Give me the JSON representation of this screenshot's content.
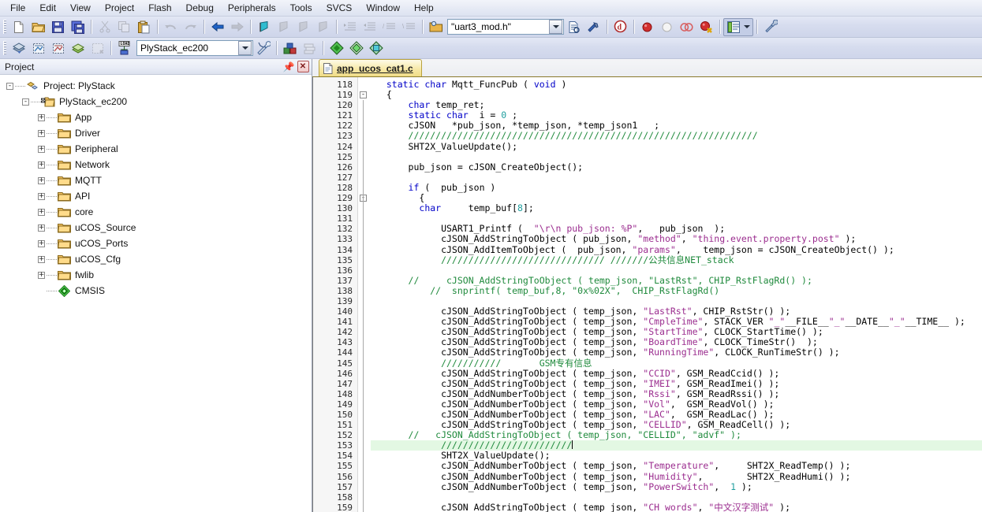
{
  "menubar": {
    "items": [
      {
        "label": "File"
      },
      {
        "label": "Edit"
      },
      {
        "label": "View"
      },
      {
        "label": "Project"
      },
      {
        "label": "Flash"
      },
      {
        "label": "Debug"
      },
      {
        "label": "Peripherals"
      },
      {
        "label": "Tools"
      },
      {
        "label": "SVCS"
      },
      {
        "label": "Window"
      },
      {
        "label": "Help"
      }
    ]
  },
  "toolbar1": {
    "file_combo_value": "\"uart3_mod.h\"",
    "icons": [
      "new-file-icon",
      "open-file-icon",
      "save-icon",
      "save-all-icon",
      "cut-icon",
      "copy-icon",
      "paste-icon",
      "undo-icon",
      "redo-icon",
      "navigate-back-icon",
      "navigate-forward-icon",
      "bookmark-toggle-icon",
      "bookmark-prev-icon",
      "bookmark-next-icon",
      "bookmark-clear-icon",
      "indent-icon",
      "outdent-icon",
      "comment-icon",
      "uncomment-icon",
      "browse-folder-icon",
      "find-in-files-icon",
      "goto-definition-icon",
      "find-icon",
      "insert-breakpoint-icon",
      "disable-breakpoint-icon",
      "disable-all-breakpoints-icon",
      "kill-all-breakpoints-icon",
      "window-layout-icon",
      "chevron-down-icon",
      "configure-icon"
    ]
  },
  "toolbar2": {
    "target_combo_value": "PlyStack_ec200",
    "icons": [
      "translate-icon",
      "build-icon",
      "rebuild-icon",
      "batch-build-icon",
      "stop-build-icon",
      "download-icon",
      "target-options-icon",
      "manage-project-items-icon",
      "components-icon",
      "pack-installer-icon",
      "manage-runtime-env-icon"
    ]
  },
  "project_pane": {
    "caption": "Project",
    "pin_icon": "pin-icon",
    "close_icon": "close-icon",
    "tree": [
      {
        "label": "Project: PlyStack",
        "depth": 0,
        "expander": "-",
        "icon": "project-icon"
      },
      {
        "label": "PlyStack_ec200",
        "depth": 1,
        "expander": "-",
        "icon": "target-folder-icon"
      },
      {
        "label": "App",
        "depth": 2,
        "expander": "+",
        "icon": "folder-icon"
      },
      {
        "label": "Driver",
        "depth": 2,
        "expander": "+",
        "icon": "folder-icon"
      },
      {
        "label": "Peripheral",
        "depth": 2,
        "expander": "+",
        "icon": "folder-icon"
      },
      {
        "label": "Network",
        "depth": 2,
        "expander": "+",
        "icon": "folder-icon"
      },
      {
        "label": "MQTT",
        "depth": 2,
        "expander": "+",
        "icon": "folder-icon"
      },
      {
        "label": "API",
        "depth": 2,
        "expander": "+",
        "icon": "folder-icon"
      },
      {
        "label": "core",
        "depth": 2,
        "expander": "+",
        "icon": "folder-icon"
      },
      {
        "label": "uCOS_Source",
        "depth": 2,
        "expander": "+",
        "icon": "folder-icon"
      },
      {
        "label": "uCOS_Ports",
        "depth": 2,
        "expander": "+",
        "icon": "folder-icon"
      },
      {
        "label": "uCOS_Cfg",
        "depth": 2,
        "expander": "+",
        "icon": "folder-icon"
      },
      {
        "label": "fwlib",
        "depth": 2,
        "expander": "+",
        "icon": "folder-icon"
      },
      {
        "label": "CMSIS",
        "depth": 2,
        "expander": "none",
        "icon": "cmsis-icon"
      }
    ]
  },
  "editor": {
    "tabs": [
      {
        "label": "app_ucos_cat1.c",
        "icon": "c-file-icon",
        "active": true
      }
    ],
    "first_line": 118,
    "current_line": 153,
    "lines": [
      {
        "n": 118,
        "fold": "",
        "bar": false,
        "tokens": [
          {
            "t": "  ",
            "c": "p"
          },
          {
            "t": "static",
            "c": "k"
          },
          {
            "t": " ",
            "c": "p"
          },
          {
            "t": "char",
            "c": "k"
          },
          {
            "t": " Mqtt_FuncPub ( ",
            "c": "p"
          },
          {
            "t": "void",
            "c": "k"
          },
          {
            "t": " )",
            "c": "p"
          }
        ]
      },
      {
        "n": 119,
        "fold": "-",
        "bar": false,
        "tokens": [
          {
            "t": "  {",
            "c": "p"
          }
        ]
      },
      {
        "n": 120,
        "fold": "",
        "bar": true,
        "tokens": [
          {
            "t": "      ",
            "c": "p"
          },
          {
            "t": "char",
            "c": "k"
          },
          {
            "t": " temp_ret;",
            "c": "p"
          }
        ]
      },
      {
        "n": 121,
        "fold": "",
        "bar": true,
        "tokens": [
          {
            "t": "      ",
            "c": "p"
          },
          {
            "t": "static",
            "c": "k"
          },
          {
            "t": " ",
            "c": "p"
          },
          {
            "t": "char",
            "c": "k"
          },
          {
            "t": "  i = ",
            "c": "p"
          },
          {
            "t": "0",
            "c": "n"
          },
          {
            "t": " ;",
            "c": "p"
          }
        ]
      },
      {
        "n": 122,
        "fold": "",
        "bar": true,
        "tokens": [
          {
            "t": "      cJSON   *pub_json, *temp_json, *temp_json1   ;",
            "c": "p"
          }
        ]
      },
      {
        "n": 123,
        "fold": "",
        "bar": true,
        "tokens": [
          {
            "t": "      ////////////////////////////////////////////////////////////////",
            "c": "c"
          }
        ]
      },
      {
        "n": 124,
        "fold": "",
        "bar": true,
        "tokens": [
          {
            "t": "      SHT2X_ValueUpdate();",
            "c": "p"
          }
        ]
      },
      {
        "n": 125,
        "fold": "",
        "bar": true,
        "tokens": [
          {
            "t": "",
            "c": "p"
          }
        ]
      },
      {
        "n": 126,
        "fold": "",
        "bar": true,
        "tokens": [
          {
            "t": "      pub_json = cJSON_CreateObject();",
            "c": "p"
          }
        ]
      },
      {
        "n": 127,
        "fold": "",
        "bar": true,
        "tokens": [
          {
            "t": "",
            "c": "p"
          }
        ]
      },
      {
        "n": 128,
        "fold": "",
        "bar": true,
        "tokens": [
          {
            "t": "      ",
            "c": "p"
          },
          {
            "t": "if",
            "c": "k"
          },
          {
            "t": " (  pub_json )",
            "c": "p"
          }
        ]
      },
      {
        "n": 129,
        "fold": "-",
        "bar": true,
        "tokens": [
          {
            "t": "        {",
            "c": "p"
          }
        ]
      },
      {
        "n": 130,
        "fold": "",
        "bar": true,
        "tokens": [
          {
            "t": "        ",
            "c": "p"
          },
          {
            "t": "char",
            "c": "k"
          },
          {
            "t": "     temp_buf[",
            "c": "p"
          },
          {
            "t": "8",
            "c": "n"
          },
          {
            "t": "];",
            "c": "p"
          }
        ]
      },
      {
        "n": 131,
        "fold": "",
        "bar": true,
        "tokens": [
          {
            "t": "",
            "c": "p"
          }
        ]
      },
      {
        "n": 132,
        "fold": "",
        "bar": true,
        "tokens": [
          {
            "t": "            USART1_Printf (  ",
            "c": "p"
          },
          {
            "t": "\"\\r\\n pub_json: %P\"",
            "c": "s"
          },
          {
            "t": ",   pub_json  );",
            "c": "p"
          }
        ]
      },
      {
        "n": 133,
        "fold": "",
        "bar": true,
        "tokens": [
          {
            "t": "            cJSON_AddStringToObject ( pub_json, ",
            "c": "p"
          },
          {
            "t": "\"method\"",
            "c": "s"
          },
          {
            "t": ", ",
            "c": "p"
          },
          {
            "t": "\"thing.event.property.post\"",
            "c": "s"
          },
          {
            "t": " );",
            "c": "p"
          }
        ]
      },
      {
        "n": 134,
        "fold": "",
        "bar": true,
        "tokens": [
          {
            "t": "            cJSON_AddItemToObject (  pub_json, ",
            "c": "p"
          },
          {
            "t": "\"params\"",
            "c": "s"
          },
          {
            "t": ",    temp_json = cJSON_CreateObject() );",
            "c": "p"
          }
        ]
      },
      {
        "n": 135,
        "fold": "",
        "bar": true,
        "tokens": [
          {
            "t": "            ////////////////////////////// ///////公共信息NET_stack",
            "c": "c"
          }
        ]
      },
      {
        "n": 136,
        "fold": "",
        "bar": true,
        "tokens": [
          {
            "t": "",
            "c": "p"
          }
        ]
      },
      {
        "n": 137,
        "fold": "",
        "bar": true,
        "tokens": [
          {
            "t": "      //     cJSON_AddStringToObject ( temp_json, \"LastRst\", CHIP_RstFlagRd() );",
            "c": "c"
          }
        ]
      },
      {
        "n": 138,
        "fold": "",
        "bar": true,
        "tokens": [
          {
            "t": "          //  snprintf( temp_buf,8, \"0x%02X\",  CHIP_RstFlagRd()",
            "c": "c"
          }
        ]
      },
      {
        "n": 139,
        "fold": "",
        "bar": true,
        "tokens": [
          {
            "t": "",
            "c": "p"
          }
        ]
      },
      {
        "n": 140,
        "fold": "",
        "bar": true,
        "tokens": [
          {
            "t": "            cJSON_AddStringToObject ( temp_json, ",
            "c": "p"
          },
          {
            "t": "\"LastRst\"",
            "c": "s"
          },
          {
            "t": ", CHIP_RstStr() );",
            "c": "p"
          }
        ]
      },
      {
        "n": 141,
        "fold": "",
        "bar": true,
        "tokens": [
          {
            "t": "            cJSON_AddStringToObject ( temp_json, ",
            "c": "p"
          },
          {
            "t": "\"CmpleTime\"",
            "c": "s"
          },
          {
            "t": ", STACK_VER ",
            "c": "p"
          },
          {
            "t": "\"_\"",
            "c": "s"
          },
          {
            "t": "__FILE__",
            "c": "p"
          },
          {
            "t": "\"_\"",
            "c": "s"
          },
          {
            "t": "__DATE__",
            "c": "p"
          },
          {
            "t": "\"_\"",
            "c": "s"
          },
          {
            "t": "__TIME__ );",
            "c": "p"
          }
        ]
      },
      {
        "n": 142,
        "fold": "",
        "bar": true,
        "tokens": [
          {
            "t": "            cJSON_AddStringToObject ( temp_json, ",
            "c": "p"
          },
          {
            "t": "\"StartTime\"",
            "c": "s"
          },
          {
            "t": ", CLOCK_StartTime() );",
            "c": "p"
          }
        ]
      },
      {
        "n": 143,
        "fold": "",
        "bar": true,
        "tokens": [
          {
            "t": "            cJSON_AddStringToObject ( temp_json, ",
            "c": "p"
          },
          {
            "t": "\"BoardTime\"",
            "c": "s"
          },
          {
            "t": ", CLOCK_TimeStr()  );",
            "c": "p"
          }
        ]
      },
      {
        "n": 144,
        "fold": "",
        "bar": true,
        "tokens": [
          {
            "t": "            cJSON_AddStringToObject ( temp_json, ",
            "c": "p"
          },
          {
            "t": "\"RunningTime\"",
            "c": "s"
          },
          {
            "t": ", CLOCK_RunTimeStr() );",
            "c": "p"
          }
        ]
      },
      {
        "n": 145,
        "fold": "",
        "bar": true,
        "tokens": [
          {
            "t": "            ///////////       GSM专有信息",
            "c": "c"
          }
        ]
      },
      {
        "n": 146,
        "fold": "",
        "bar": true,
        "tokens": [
          {
            "t": "            cJSON_AddStringToObject ( temp_json, ",
            "c": "p"
          },
          {
            "t": "\"CCID\"",
            "c": "s"
          },
          {
            "t": ", GSM_ReadCcid() );",
            "c": "p"
          }
        ]
      },
      {
        "n": 147,
        "fold": "",
        "bar": true,
        "tokens": [
          {
            "t": "            cJSON_AddStringToObject ( temp_json, ",
            "c": "p"
          },
          {
            "t": "\"IMEI\"",
            "c": "s"
          },
          {
            "t": ", GSM_ReadImei() );",
            "c": "p"
          }
        ]
      },
      {
        "n": 148,
        "fold": "",
        "bar": true,
        "tokens": [
          {
            "t": "            cJSON_AddNumberToObject ( temp_json, ",
            "c": "p"
          },
          {
            "t": "\"Rssi\"",
            "c": "s"
          },
          {
            "t": ", GSM_ReadRssi() );",
            "c": "p"
          }
        ]
      },
      {
        "n": 149,
        "fold": "",
        "bar": true,
        "tokens": [
          {
            "t": "            cJSON_AddNumberToObject ( temp_json, ",
            "c": "p"
          },
          {
            "t": "\"Vol\"",
            "c": "s"
          },
          {
            "t": ",  GSM_ReadVol() );",
            "c": "p"
          }
        ]
      },
      {
        "n": 150,
        "fold": "",
        "bar": true,
        "tokens": [
          {
            "t": "            cJSON_AddNumberToObject ( temp_json, ",
            "c": "p"
          },
          {
            "t": "\"LAC\"",
            "c": "s"
          },
          {
            "t": ",  GSM_ReadLac() );",
            "c": "p"
          }
        ]
      },
      {
        "n": 151,
        "fold": "",
        "bar": true,
        "tokens": [
          {
            "t": "            cJSON_AddStringToObject ( temp_json, ",
            "c": "p"
          },
          {
            "t": "\"CELLID\"",
            "c": "s"
          },
          {
            "t": ", GSM_ReadCell() );",
            "c": "p"
          }
        ]
      },
      {
        "n": 152,
        "fold": "",
        "bar": true,
        "tokens": [
          {
            "t": "      //   cJSON_AddStringToObject ( temp_json, \"CELLID\", \"advf\" );",
            "c": "c"
          }
        ]
      },
      {
        "n": 153,
        "fold": "",
        "bar": true,
        "cur": true,
        "tokens": [
          {
            "t": "            ////////////////////////",
            "c": "c"
          },
          {
            "t": "|caret|",
            "c": "caret"
          }
        ]
      },
      {
        "n": 154,
        "fold": "",
        "bar": true,
        "tokens": [
          {
            "t": "            SHT2X_ValueUpdate();",
            "c": "p"
          }
        ]
      },
      {
        "n": 155,
        "fold": "",
        "bar": true,
        "tokens": [
          {
            "t": "            cJSON_AddNumberToObject ( temp_json, ",
            "c": "p"
          },
          {
            "t": "\"Temperature\"",
            "c": "s"
          },
          {
            "t": ",     SHT2X_ReadTemp() );",
            "c": "p"
          }
        ]
      },
      {
        "n": 156,
        "fold": "",
        "bar": true,
        "tokens": [
          {
            "t": "            cJSON_AddNumberToObject ( temp_json, ",
            "c": "p"
          },
          {
            "t": "\"Humidity\"",
            "c": "s"
          },
          {
            "t": ",        SHT2X_ReadHumi() );",
            "c": "p"
          }
        ]
      },
      {
        "n": 157,
        "fold": "",
        "bar": true,
        "tokens": [
          {
            "t": "            cJSON_AddNumberToObject ( temp_json, ",
            "c": "p"
          },
          {
            "t": "\"PowerSwitch\"",
            "c": "s"
          },
          {
            "t": ",  ",
            "c": "p"
          },
          {
            "t": "1",
            "c": "n"
          },
          {
            "t": " );",
            "c": "p"
          }
        ]
      },
      {
        "n": 158,
        "fold": "",
        "bar": true,
        "tokens": [
          {
            "t": "",
            "c": "p"
          }
        ]
      },
      {
        "n": 159,
        "fold": "",
        "bar": true,
        "tokens": [
          {
            "t": "            cJSON_AddStringToObject ( temp_json, ",
            "c": "p"
          },
          {
            "t": "\"CH_words\"",
            "c": "s"
          },
          {
            "t": ", ",
            "c": "p"
          },
          {
            "t": "\"中文汉字测试\"",
            "c": "s"
          },
          {
            "t": " );",
            "c": "p"
          }
        ]
      }
    ]
  },
  "colors": {
    "toolbar_bg": "#d6dcee",
    "menubar_bg": "#e7ebf5",
    "tab_active": "#f7e9a8",
    "current_line": "#e3f8e3",
    "comment_green": "#1f8a3c",
    "string_magenta": "#9b2d8f",
    "keyword_blue": "#0000c8"
  }
}
